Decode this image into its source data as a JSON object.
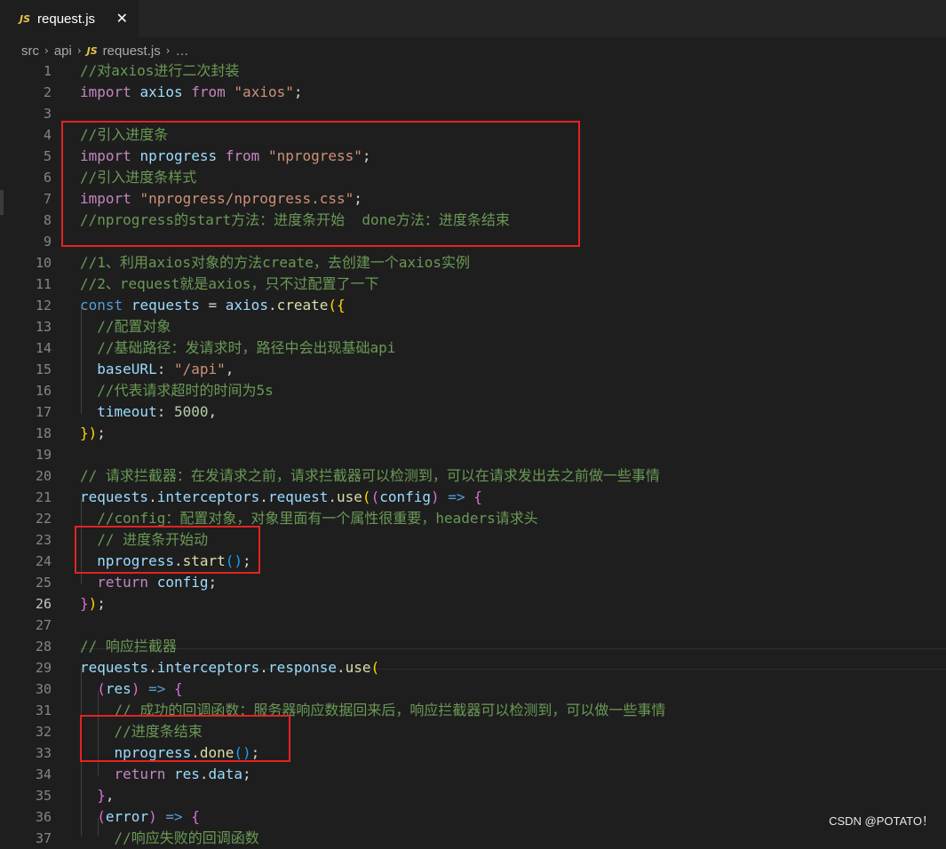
{
  "tab": {
    "badge": "JS",
    "title": "request.js",
    "close": "✕"
  },
  "breadcrumb": {
    "src": "src",
    "sep": "›",
    "api": "api",
    "badge": "JS",
    "file": "request.js",
    "more": "…"
  },
  "watermark": "CSDN @POTATO！",
  "active_line": 26,
  "lines": [
    {
      "n": "1",
      "t": [
        [
          "c",
          "//对axios进行二次封装"
        ]
      ]
    },
    {
      "n": "2",
      "t": [
        [
          "k",
          "import"
        ],
        [
          "d",
          " "
        ],
        [
          "v",
          "axios"
        ],
        [
          "d",
          " "
        ],
        [
          "k",
          "from"
        ],
        [
          "d",
          " "
        ],
        [
          "s",
          "\"axios\""
        ],
        [
          "d",
          ";"
        ]
      ]
    },
    {
      "n": "3",
      "t": []
    },
    {
      "n": "4",
      "t": [
        [
          "c",
          "//引入进度条"
        ]
      ]
    },
    {
      "n": "5",
      "t": [
        [
          "k",
          "import"
        ],
        [
          "d",
          " "
        ],
        [
          "v",
          "nprogress"
        ],
        [
          "d",
          " "
        ],
        [
          "k",
          "from"
        ],
        [
          "d",
          " "
        ],
        [
          "s",
          "\"nprogress\""
        ],
        [
          "d",
          ";"
        ]
      ]
    },
    {
      "n": "6",
      "t": [
        [
          "c",
          "//引入进度条样式"
        ]
      ]
    },
    {
      "n": "7",
      "t": [
        [
          "k",
          "import"
        ],
        [
          "d",
          " "
        ],
        [
          "s",
          "\"nprogress/nprogress.css\""
        ],
        [
          "d",
          ";"
        ]
      ]
    },
    {
      "n": "8",
      "t": [
        [
          "c",
          "//nprogress的start方法：进度条开始  done方法：进度条结束"
        ]
      ]
    },
    {
      "n": "9",
      "t": []
    },
    {
      "n": "10",
      "t": [
        [
          "c",
          "//1、利用axios对象的方法create，去创建一个axios实例"
        ]
      ]
    },
    {
      "n": "11",
      "t": [
        [
          "c",
          "//2、request就是axios，只不过配置了一下"
        ]
      ]
    },
    {
      "n": "12",
      "t": [
        [
          "b",
          "const"
        ],
        [
          "d",
          " "
        ],
        [
          "v",
          "requests"
        ],
        [
          "d",
          " = "
        ],
        [
          "v",
          "axios"
        ],
        [
          "d",
          "."
        ],
        [
          "f",
          "create"
        ],
        [
          "y",
          "({"
        ]
      ]
    },
    {
      "n": "13",
      "t": [
        [
          "d",
          "  "
        ],
        [
          "c",
          "//配置对象"
        ]
      ]
    },
    {
      "n": "14",
      "t": [
        [
          "d",
          "  "
        ],
        [
          "c",
          "//基础路径：发请求时，路径中会出现基础api"
        ]
      ]
    },
    {
      "n": "15",
      "t": [
        [
          "d",
          "  "
        ],
        [
          "v",
          "baseURL"
        ],
        [
          "d",
          ": "
        ],
        [
          "s",
          "\"/api\""
        ],
        [
          "d",
          ","
        ]
      ]
    },
    {
      "n": "16",
      "t": [
        [
          "d",
          "  "
        ],
        [
          "c",
          "//代表请求超时的时间为5s"
        ]
      ]
    },
    {
      "n": "17",
      "t": [
        [
          "d",
          "  "
        ],
        [
          "v",
          "timeout"
        ],
        [
          "d",
          ": "
        ],
        [
          "n",
          "5000"
        ],
        [
          "d",
          ","
        ]
      ]
    },
    {
      "n": "18",
      "t": [
        [
          "y",
          "})"
        ],
        [
          "d",
          ";"
        ]
      ]
    },
    {
      "n": "19",
      "t": []
    },
    {
      "n": "20",
      "t": [
        [
          "c",
          "// 请求拦截器：在发请求之前，请求拦截器可以检测到，可以在请求发出去之前做一些事情"
        ]
      ]
    },
    {
      "n": "21",
      "t": [
        [
          "v",
          "requests"
        ],
        [
          "d",
          "."
        ],
        [
          "v",
          "interceptors"
        ],
        [
          "d",
          "."
        ],
        [
          "v",
          "request"
        ],
        [
          "d",
          "."
        ],
        [
          "f",
          "use"
        ],
        [
          "y",
          "("
        ],
        [
          "p",
          "("
        ],
        [
          "v",
          "config"
        ],
        [
          "p",
          ")"
        ],
        [
          "d",
          " "
        ],
        [
          "b",
          "=>"
        ],
        [
          "d",
          " "
        ],
        [
          "p",
          "{"
        ]
      ]
    },
    {
      "n": "22",
      "t": [
        [
          "d",
          "  "
        ],
        [
          "c",
          "//config：配置对象，对象里面有一个属性很重要，headers请求头"
        ]
      ]
    },
    {
      "n": "23",
      "t": [
        [
          "d",
          "  "
        ],
        [
          "c",
          "// 进度条开始动"
        ]
      ]
    },
    {
      "n": "24",
      "t": [
        [
          "d",
          "  "
        ],
        [
          "v",
          "nprogress"
        ],
        [
          "d",
          "."
        ],
        [
          "f",
          "start"
        ],
        [
          "q",
          "()"
        ],
        [
          "d",
          ";"
        ]
      ]
    },
    {
      "n": "25",
      "t": [
        [
          "d",
          "  "
        ],
        [
          "k",
          "return"
        ],
        [
          "d",
          " "
        ],
        [
          "v",
          "config"
        ],
        [
          "d",
          ";"
        ]
      ]
    },
    {
      "n": "26",
      "t": [
        [
          "p",
          "}"
        ],
        [
          "y",
          ")"
        ],
        [
          "d",
          ";"
        ]
      ]
    },
    {
      "n": "27",
      "t": []
    },
    {
      "n": "28",
      "t": [
        [
          "c",
          "// 响应拦截器"
        ]
      ]
    },
    {
      "n": "29",
      "t": [
        [
          "v",
          "requests"
        ],
        [
          "d",
          "."
        ],
        [
          "v",
          "interceptors"
        ],
        [
          "d",
          "."
        ],
        [
          "v",
          "response"
        ],
        [
          "d",
          "."
        ],
        [
          "f",
          "use"
        ],
        [
          "y",
          "("
        ]
      ]
    },
    {
      "n": "30",
      "t": [
        [
          "d",
          "  "
        ],
        [
          "p",
          "("
        ],
        [
          "v",
          "res"
        ],
        [
          "p",
          ")"
        ],
        [
          "d",
          " "
        ],
        [
          "b",
          "=>"
        ],
        [
          "d",
          " "
        ],
        [
          "p",
          "{"
        ]
      ]
    },
    {
      "n": "31",
      "t": [
        [
          "d",
          "    "
        ],
        [
          "c",
          "// 成功的回调函数：服务器响应数据回来后，响应拦截器可以检测到，可以做一些事情"
        ]
      ]
    },
    {
      "n": "32",
      "t": [
        [
          "d",
          "    "
        ],
        [
          "c",
          "//进度条结束"
        ]
      ]
    },
    {
      "n": "33",
      "t": [
        [
          "d",
          "    "
        ],
        [
          "v",
          "nprogress"
        ],
        [
          "d",
          "."
        ],
        [
          "f",
          "done"
        ],
        [
          "q",
          "()"
        ],
        [
          "d",
          ";"
        ]
      ]
    },
    {
      "n": "34",
      "t": [
        [
          "d",
          "    "
        ],
        [
          "k",
          "return"
        ],
        [
          "d",
          " "
        ],
        [
          "v",
          "res"
        ],
        [
          "d",
          "."
        ],
        [
          "v",
          "data"
        ],
        [
          "d",
          ";"
        ]
      ]
    },
    {
      "n": "35",
      "t": [
        [
          "d",
          "  "
        ],
        [
          "p",
          "}"
        ],
        [
          "d",
          ","
        ]
      ]
    },
    {
      "n": "36",
      "t": [
        [
          "d",
          "  "
        ],
        [
          "p",
          "("
        ],
        [
          "v",
          "error"
        ],
        [
          "p",
          ")"
        ],
        [
          "d",
          " "
        ],
        [
          "b",
          "=>"
        ],
        [
          "d",
          " "
        ],
        [
          "p",
          "{"
        ]
      ]
    },
    {
      "n": "37",
      "t": [
        [
          "d",
          "    "
        ],
        [
          "c",
          "//响应失败的回调函数"
        ]
      ]
    }
  ]
}
